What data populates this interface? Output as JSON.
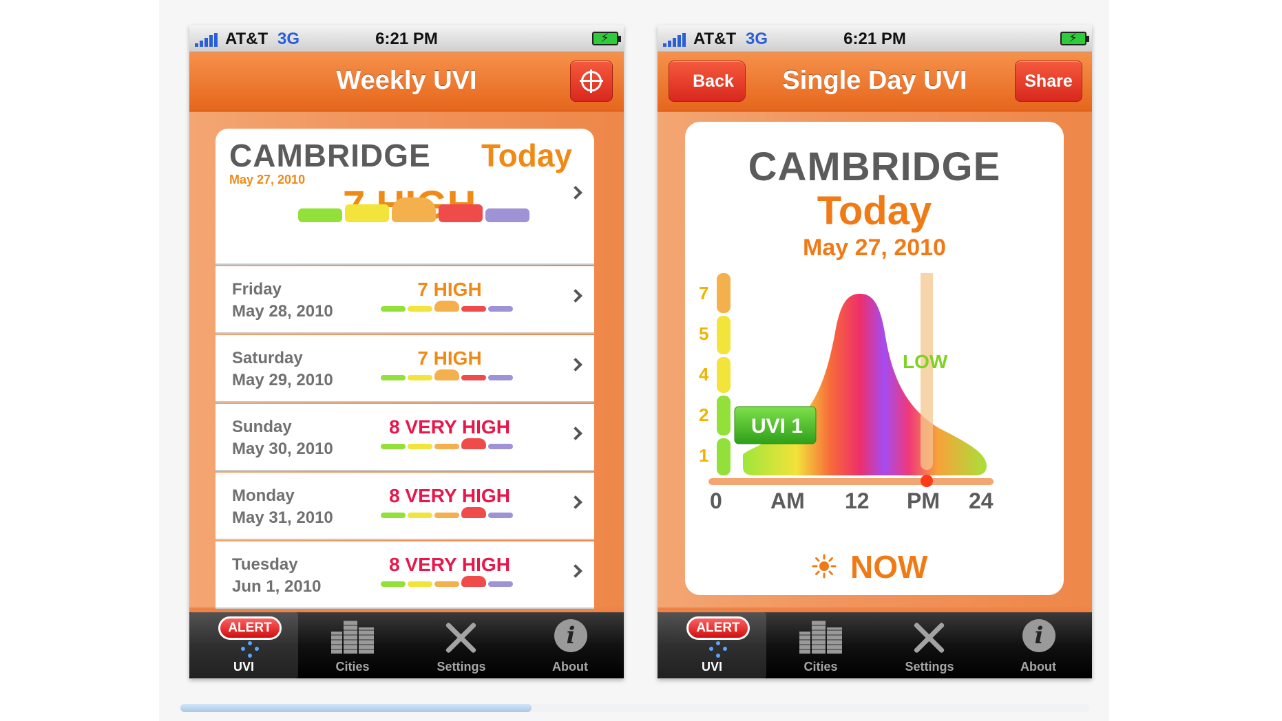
{
  "status_bar": {
    "carrier": "AT&T",
    "network": "3G",
    "time": "6:21 PM"
  },
  "weekly_screen": {
    "title": "Weekly UVI",
    "today": {
      "city": "CAMBRIDGE",
      "day_label": "Today",
      "date": "May 27, 2010",
      "uvi": "7 HIGH",
      "scale_level": 3
    },
    "days": [
      {
        "name": "Friday",
        "date": "May 28, 2010",
        "uvi": "7 HIGH",
        "level": "high"
      },
      {
        "name": "Saturday",
        "date": "May 29, 2010",
        "uvi": "7 HIGH",
        "level": "high"
      },
      {
        "name": "Sunday",
        "date": "May 30, 2010",
        "uvi": "8 VERY HIGH",
        "level": "vhigh"
      },
      {
        "name": "Monday",
        "date": "May 31, 2010",
        "uvi": "8 VERY HIGH",
        "level": "vhigh"
      },
      {
        "name": "Tuesday",
        "date": "Jun 1, 2010",
        "uvi": "8 VERY HIGH",
        "level": "vhigh"
      }
    ]
  },
  "single_day_screen": {
    "title": "Single Day UVI",
    "back_label": "Back",
    "share_label": "Share",
    "city": "CAMBRIDGE",
    "day_label": "Today",
    "date": "May 27, 2010",
    "y_ticks": [
      "7",
      "5",
      "4",
      "2",
      "1"
    ],
    "x_ticks": [
      "0",
      "AM",
      "12",
      "PM",
      "24"
    ],
    "current_uvi_badge": "UVI 1",
    "current_level": "LOW",
    "now_label": "NOW"
  },
  "tab_bar": {
    "alert_label": "ALERT",
    "tabs": [
      "UVI",
      "Cities",
      "Settings",
      "About"
    ],
    "active_tab": "UVI"
  },
  "colors": {
    "nav_orange": "#ee7a2e",
    "high": "#f08a16",
    "very_high": "#e8164a",
    "low": "#7ed321",
    "scale": [
      "#93e03a",
      "#f3e43c",
      "#f3b04c",
      "#f04b4b",
      "#9f93d6"
    ]
  }
}
